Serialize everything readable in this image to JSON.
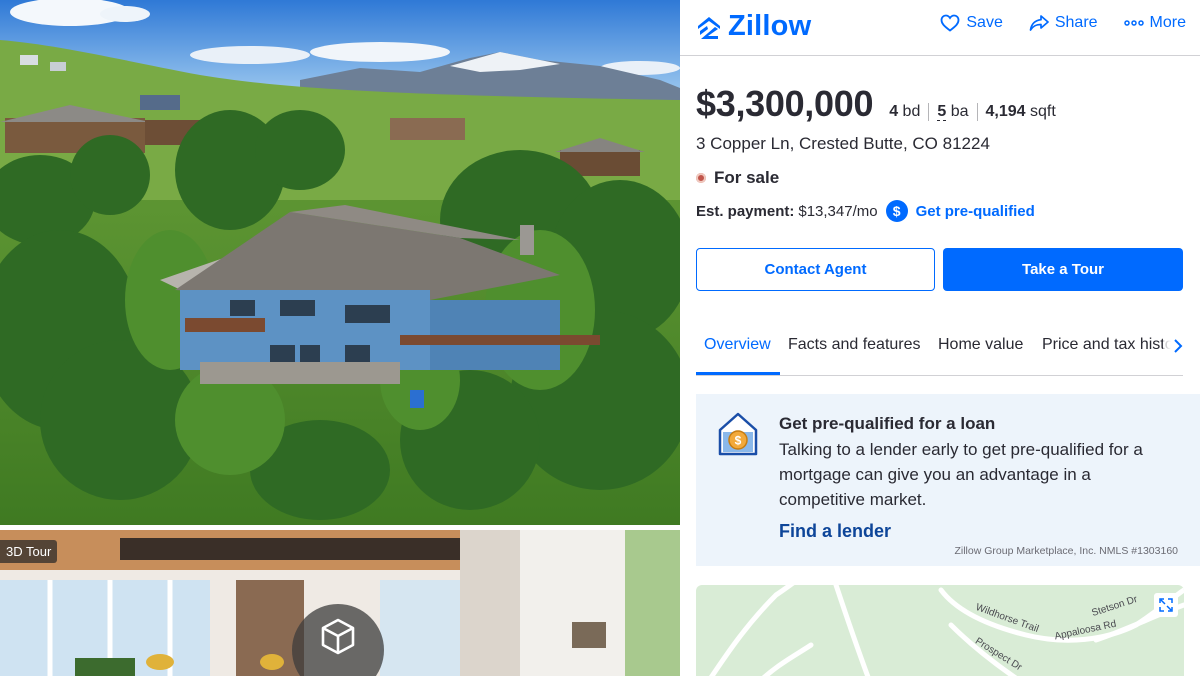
{
  "header": {
    "logo": "Zillow",
    "actions": [
      {
        "label": "Save",
        "icon": "heart-icon"
      },
      {
        "label": "Share",
        "icon": "share-icon"
      },
      {
        "label": "More",
        "icon": "more-icon"
      }
    ]
  },
  "gallery": {
    "tour_badge": "3D Tour"
  },
  "listing": {
    "price": "$3,300,000",
    "beds_value": "4",
    "beds_unit": "bd",
    "baths_value": "5",
    "baths_unit": "ba",
    "sqft_value": "4,194",
    "sqft_unit": "sqft",
    "address": "3 Copper Ln, Crested Butte, CO 81224",
    "status": "For sale",
    "payment_label": "Est. payment:",
    "payment_value": "$13,347/mo",
    "prequal_link": "Get pre-qualified"
  },
  "buttons": {
    "contact": "Contact Agent",
    "tour": "Take a Tour"
  },
  "tabs": [
    "Overview",
    "Facts and features",
    "Home value",
    "Price and tax history"
  ],
  "promo": {
    "title": "Get pre-qualified for a loan",
    "body": "Talking to a lender early to get pre-qualified for a mortgage can give you an advantage in a competitive market.",
    "link": "Find a lender",
    "note": "Zillow Group Marketplace, Inc. NMLS #1303160"
  },
  "map": {
    "roads": [
      "Wildhorse Trail",
      "Stetson Dr",
      "Appaloosa Rd",
      "Prospect Dr"
    ]
  },
  "colors": {
    "brand": "#006aff",
    "status_dot": "#c1554b",
    "promo_bg": "#edf4fb",
    "map_bg": "#d9ecd6"
  }
}
